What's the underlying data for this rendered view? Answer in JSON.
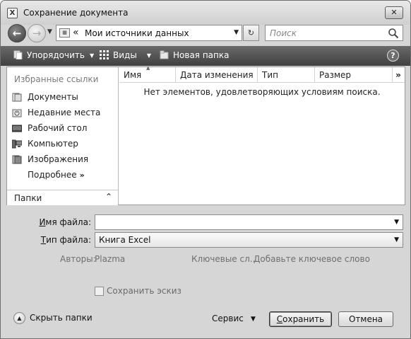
{
  "window": {
    "title": "Сохранение документа",
    "app_icon_glyph": "X",
    "close_glyph": "✕"
  },
  "nav": {
    "back_glyph": "←",
    "forward_glyph": "→",
    "history_drop": "▼",
    "address_chevron": "«",
    "address_text": "Мои источники данных",
    "address_drop": "▼",
    "refresh_glyph": "↻",
    "search_placeholder": "Поиск"
  },
  "toolbar": {
    "organize": "Упорядочить",
    "views": "Виды",
    "new_folder": "Новая папка",
    "dropdown_arrow": "▼",
    "help_glyph": "?"
  },
  "sidebar": {
    "header": "Избранные ссылки",
    "items": [
      {
        "label": "Документы",
        "icon": "documents-icon"
      },
      {
        "label": "Недавние места",
        "icon": "recent-places-icon"
      },
      {
        "label": "Рабочий стол",
        "icon": "desktop-icon"
      },
      {
        "label": "Компьютер",
        "icon": "computer-icon"
      },
      {
        "label": "Изображения",
        "icon": "pictures-icon"
      }
    ],
    "more": "Подробнее",
    "more_chevron": "»",
    "folders": "Папки",
    "folders_chevron": "⌃"
  },
  "list": {
    "columns": [
      "Имя",
      "Дата изменения",
      "Тип",
      "Размер"
    ],
    "sort_glyph": "▲",
    "more_columns": "»",
    "empty_message": "Нет элементов, удовлетворяющих условиям поиска."
  },
  "form": {
    "filename_label_u": "И",
    "filename_label_rest": "мя файла:",
    "filename_value": "",
    "filetype_label_u": "Т",
    "filetype_label_rest": "ип файла:",
    "filetype_value": "Книга Excel",
    "drop_glyph": "▼",
    "authors_label": "Авторы:",
    "authors_value": "Plazma",
    "keywords_label": "Ключевые сл...",
    "keywords_value": "Добавьте ключевое слово",
    "thumbnail_label": "Сохранить эскиз"
  },
  "footer": {
    "hide_folders": "Скрыть папки",
    "hide_glyph": "▲",
    "service": "Сервис",
    "service_drop": "▼",
    "save_u": "С",
    "save_rest": "охранить",
    "cancel": "Отмена"
  },
  "colors": {
    "toolbar_bg": "#4f4f4f",
    "window_bg": "#d6d6d6"
  }
}
